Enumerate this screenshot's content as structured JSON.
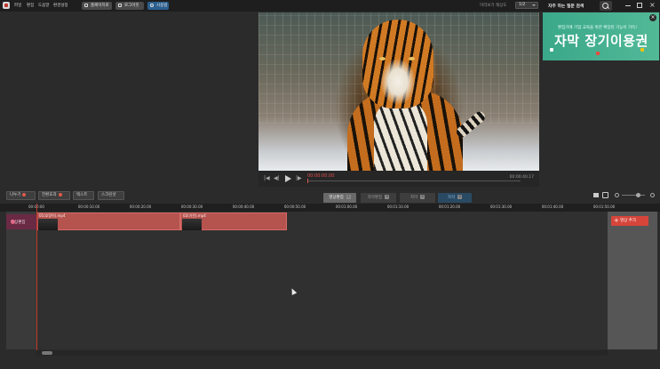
{
  "menu": [
    "파일",
    "편집",
    "도움말",
    "환경설정"
  ],
  "toolbar": {
    "homepage": "홈페이지로",
    "login": "로그아웃",
    "user": "사용법"
  },
  "preview_resolution": {
    "label": "미리보기 해상도",
    "value": "1/2"
  },
  "faq": "자주 하는 질문 검색",
  "banner": {
    "subtitle": "편집기에 기업 교육을 위한 확장된 기능이 가득!",
    "title": "자막 장기이용권"
  },
  "player": {
    "current_time": "00:00:00.00",
    "end_time": "00:00:40.17"
  },
  "tabs": [
    {
      "label": "영상편집",
      "count": "1"
    },
    {
      "label": "자막편집",
      "count": "0"
    },
    {
      "label": "자막",
      "count": "0"
    },
    {
      "label": "자석",
      "count": "0"
    }
  ],
  "timeline_tools": [
    {
      "label": "나누기"
    },
    {
      "label": "전환효과"
    },
    {
      "label": "텍스트"
    },
    {
      "label": "스크린샷"
    }
  ],
  "ruler_ticks": [
    "00:00:00",
    "00:00:10.00",
    "00:00:20.00",
    "00:00:30.00",
    "00:00:40.00",
    "00:00:50.00",
    "00:01:00.00",
    "00:01:10.00",
    "00:01:20.00",
    "00:01:30.00",
    "00:01:40.00",
    "00:01:50.00"
  ],
  "track": {
    "label": "영상편집"
  },
  "clips": [
    {
      "name": "01(호랑이).mp4"
    },
    {
      "name": "02(기린).mp4"
    }
  ],
  "add_button": "영상 추가",
  "colors": {
    "accent_red": "#d6453a",
    "track_color": "#6a2a44",
    "clip_color": "#b5534f"
  }
}
